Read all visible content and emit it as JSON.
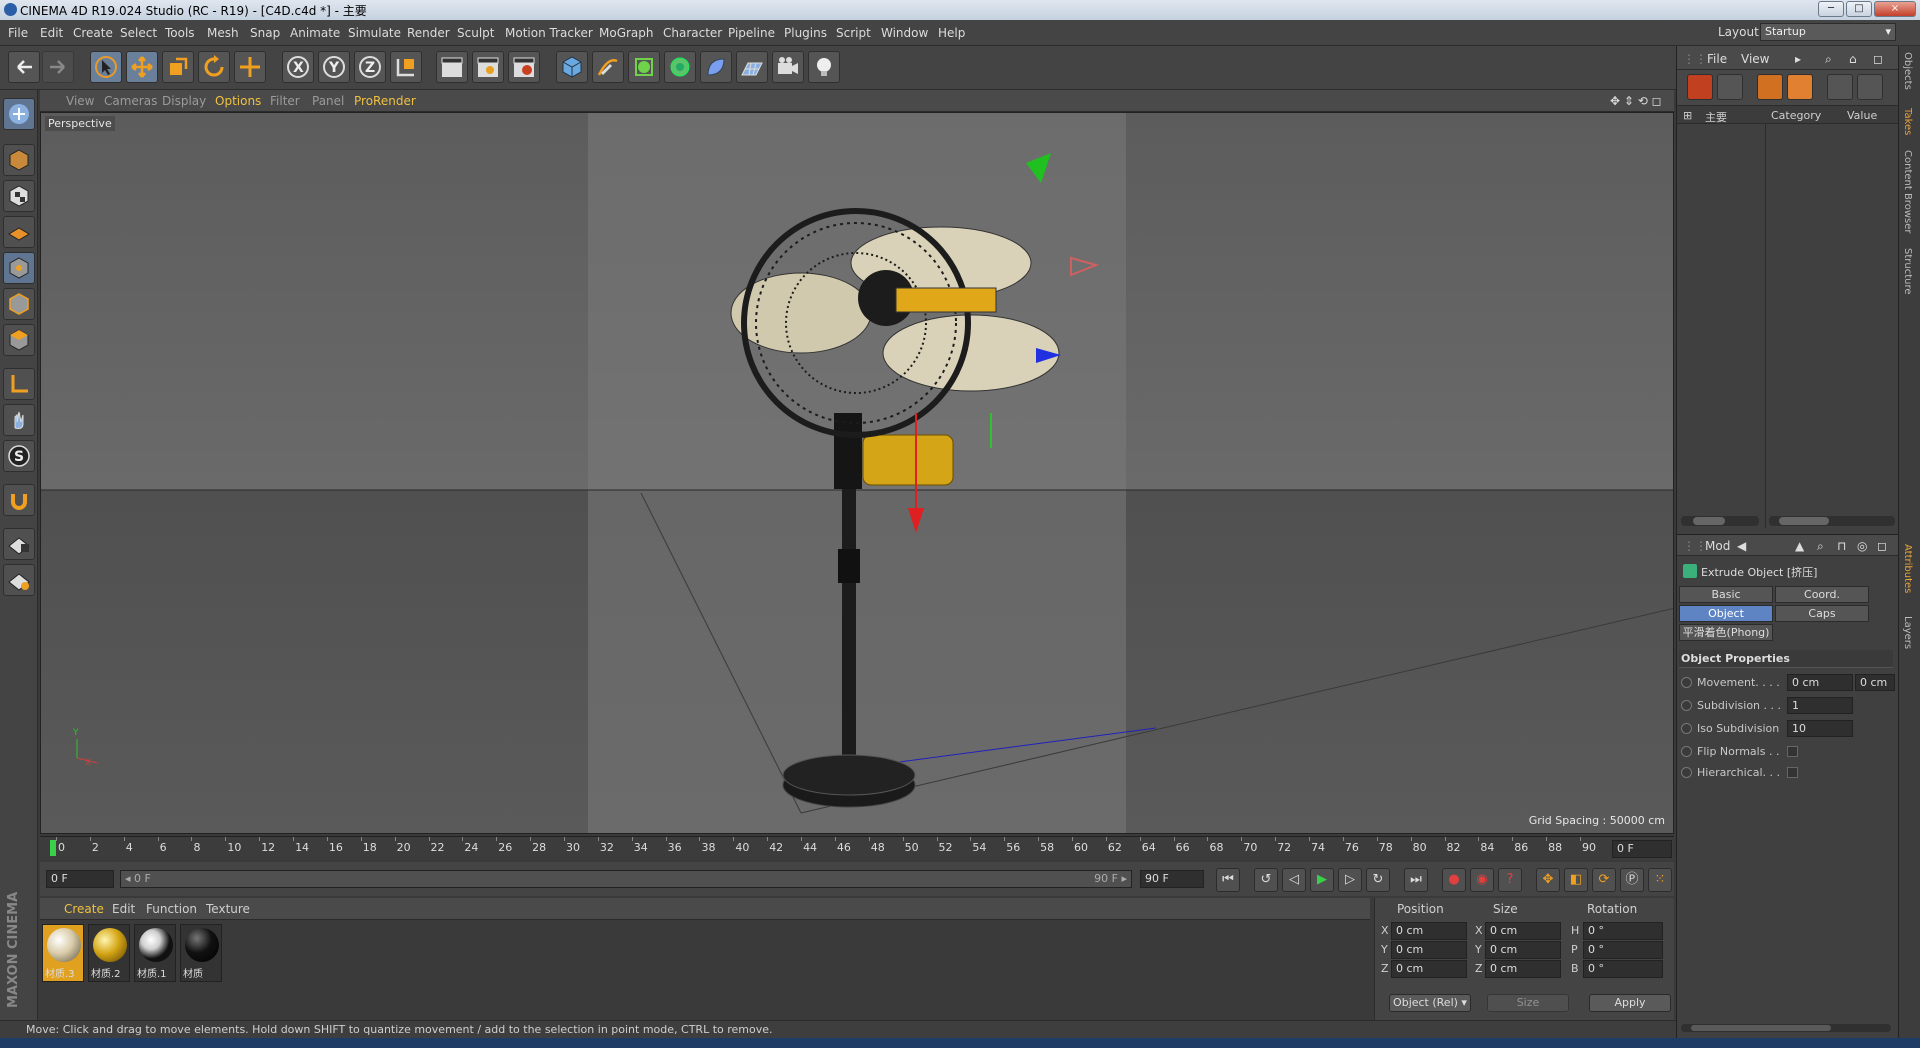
{
  "window": {
    "title": "CINEMA 4D R19.024 Studio (RC - R19) - [C4D.c4d *] - 主要",
    "btn_min": "─",
    "btn_max": "□",
    "btn_close": "×"
  },
  "menu": [
    "File",
    "Edit",
    "Create",
    "Select",
    "Tools",
    "Mesh",
    "Snap",
    "Animate",
    "Simulate",
    "Sculpt",
    "Render",
    "Sculpt",
    "Motion Tracker",
    "MoGraph",
    "Character",
    "Pipeline",
    "Plugins",
    "Script",
    "Window",
    "Help"
  ],
  "layout": {
    "label": "Layout:",
    "value": "Startup"
  },
  "viewport": {
    "menu": [
      "View",
      "Cameras",
      "Display",
      "Options",
      "Filter",
      "Panel",
      "ProRender"
    ],
    "active_menu": "Options",
    "label": "Perspective",
    "grid_spacing": "Grid Spacing : 50000 cm"
  },
  "timeline": {
    "ticks": [
      "0",
      "2",
      "4",
      "6",
      "8",
      "10",
      "12",
      "14",
      "16",
      "18",
      "20",
      "22",
      "24",
      "26",
      "28",
      "30",
      "32",
      "34",
      "36",
      "38",
      "40",
      "42",
      "44",
      "46",
      "48",
      "50",
      "52",
      "54",
      "56",
      "58",
      "60",
      "62",
      "64",
      "66",
      "68",
      "70",
      "72",
      "74",
      "76",
      "78",
      "80",
      "82",
      "84",
      "86",
      "88",
      "90"
    ],
    "end_field": "0 F",
    "start_frame": "0 F",
    "slider_left": "◂ 0 F",
    "slider_right": "90 F ▸",
    "max_frame": "90 F"
  },
  "materials": {
    "menu": [
      "Create",
      "Edit",
      "Function",
      "Texture"
    ],
    "items": [
      {
        "label": "材质.3",
        "color": "#d9cba8"
      },
      {
        "label": "材质.2",
        "color": "#d4a516"
      },
      {
        "label": "材质.1",
        "color": "#cfcfcf"
      },
      {
        "label": "材质",
        "color": "#111111"
      }
    ]
  },
  "coords": {
    "headers": {
      "position": "Position",
      "size": "Size",
      "rotation": "Rotation"
    },
    "rows": [
      {
        "axis": "X",
        "pos": "0 cm",
        "saxis": "X",
        "size": "0 cm",
        "raxis": "H",
        "rot": "0 °"
      },
      {
        "axis": "Y",
        "pos": "0 cm",
        "saxis": "Y",
        "size": "0 cm",
        "raxis": "P",
        "rot": "0 °"
      },
      {
        "axis": "Z",
        "pos": "0 cm",
        "saxis": "Z",
        "size": "0 cm",
        "raxis": "B",
        "rot": "0 °"
      }
    ],
    "mode": "Object (Rel) ▾",
    "size_mode": "Size",
    "apply": "Apply"
  },
  "status": "Move: Click and drag to move elements. Hold down SHIFT to quantize movement / add to the selection in point mode, CTRL to remove.",
  "objects": {
    "menu": [
      "File",
      "View"
    ],
    "columns": {
      "name": "主要",
      "category": "Category",
      "value": "Value"
    }
  },
  "attributes": {
    "menu": "Mod",
    "object_name": "Extrude Object [挤压]",
    "tabs": [
      "Basic",
      "Coord.",
      "Object",
      "Caps"
    ],
    "active_tab": "Object",
    "phong": "平滑着色(Phong)",
    "section": "Object Properties",
    "props": [
      {
        "label": "Movement. . . .",
        "value": "0 cm",
        "value2": "0 cm"
      },
      {
        "label": "Subdivision . . .",
        "value": "1"
      },
      {
        "label": "Iso Subdivision",
        "value": "10"
      },
      {
        "label": "Flip Normals . ."
      },
      {
        "label": "Hierarchical. . ."
      }
    ]
  },
  "side_tabs": [
    "Objects",
    "Takes",
    "Content Browser",
    "Structure",
    "Attributes",
    "Layers"
  ],
  "brand": "MAXON CINEMA 4D"
}
